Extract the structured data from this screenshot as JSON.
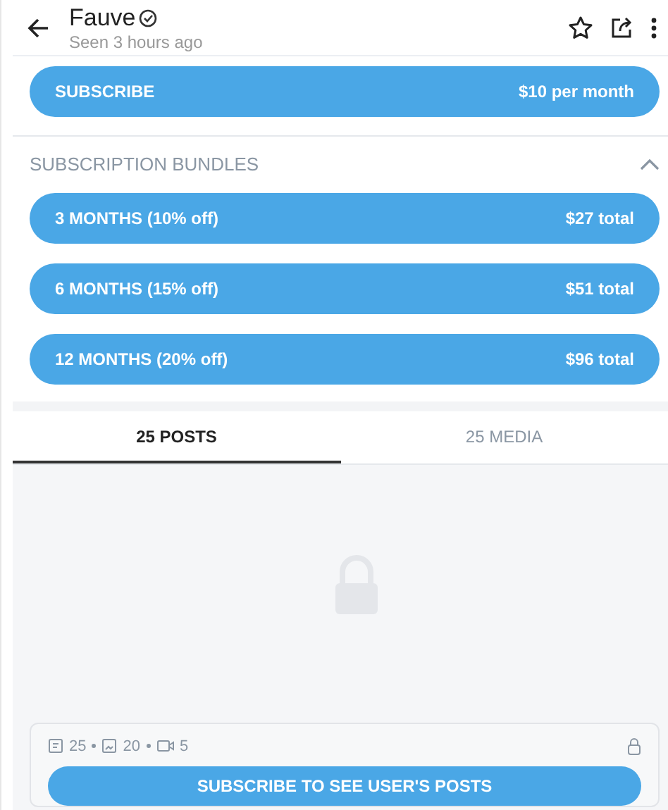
{
  "header": {
    "name": "Fauve",
    "verified": true,
    "status": "Seen  3 hours ago"
  },
  "subscribe": {
    "label": "SUBSCRIBE",
    "price": "$10 per month"
  },
  "bundles": {
    "title": "SUBSCRIPTION BUNDLES",
    "expanded": true,
    "items": [
      {
        "label": "3 MONTHS (10% off)",
        "price": "$27 total"
      },
      {
        "label": "6 MONTHS (15% off)",
        "price": "$51 total"
      },
      {
        "label": "12 MONTHS (20% off)",
        "price": "$96 total"
      }
    ]
  },
  "tabs": [
    {
      "label": "25 POSTS",
      "selected": true
    },
    {
      "label": "25 MEDIA",
      "selected": false
    }
  ],
  "locked": {
    "counts": [
      {
        "kind": "post",
        "value": "25"
      },
      {
        "kind": "image",
        "value": "20"
      },
      {
        "kind": "video",
        "value": "5"
      }
    ],
    "button": "SUBSCRIBE TO SEE USER'S POSTS"
  }
}
